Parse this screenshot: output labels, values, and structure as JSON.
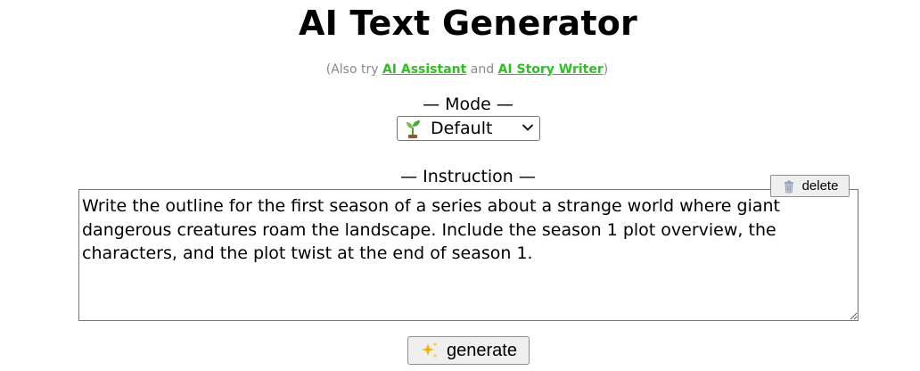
{
  "page": {
    "title": "AI Text Generator"
  },
  "also_try": {
    "prefix": "(Also try ",
    "link1": "AI Assistant",
    "middle": " and ",
    "link2": "AI Story Writer",
    "suffix": ")"
  },
  "mode": {
    "label": "— Mode —",
    "selected": "Default",
    "icon": "sprout-icon"
  },
  "instruction": {
    "label": "— Instruction —",
    "value": "Write the outline for the first season of a series about a strange world where giant dangerous creatures roam the landscape. Include the season 1 plot overview, the characters, and the plot twist at the end of season 1.",
    "delete_label": "delete",
    "delete_icon": "trash-icon"
  },
  "generate": {
    "label": "generate",
    "icon": "sparkles-icon"
  },
  "colors": {
    "link": "#2fbf22",
    "muted": "#8a8a8a"
  }
}
